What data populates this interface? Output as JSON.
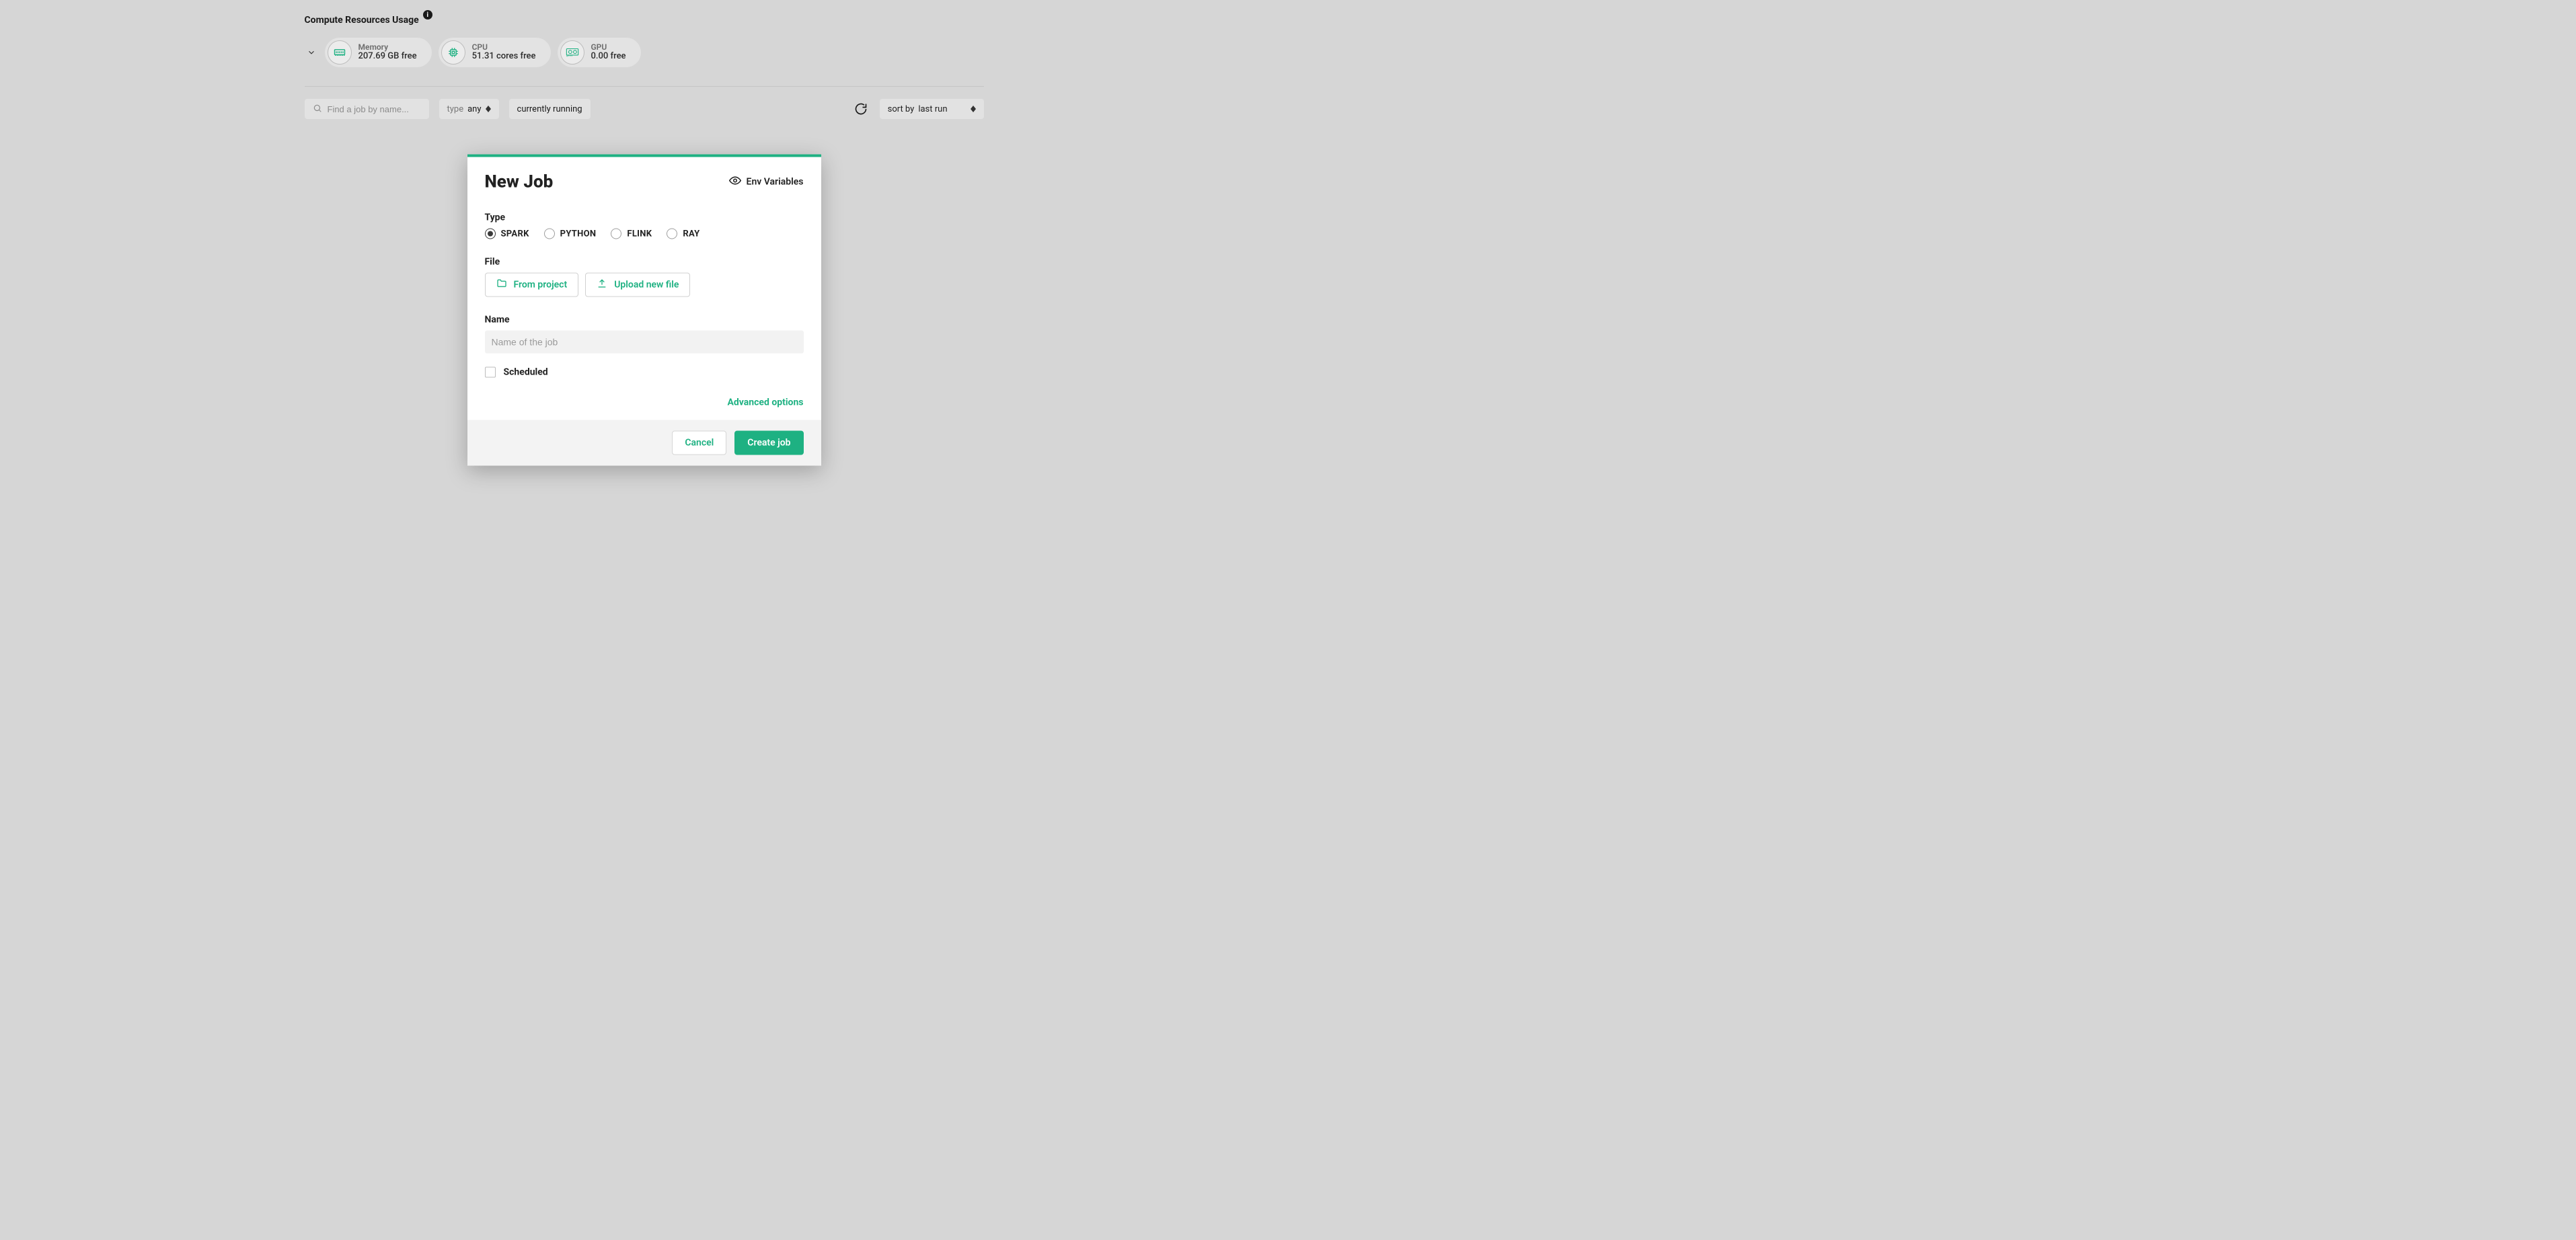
{
  "header": {
    "title": "Compute Resources Usage",
    "info_tooltip": "i"
  },
  "resources": {
    "memory": {
      "label": "Memory",
      "value": "207.69 GB free"
    },
    "cpu": {
      "label": "CPU",
      "value": "51.31 cores free"
    },
    "gpu": {
      "label": "GPU",
      "value": "0.00 free"
    }
  },
  "toolbar": {
    "search_placeholder": "Find a job by name...",
    "type_label": "type",
    "type_value": "any",
    "running_filter": "currently running",
    "sort_label": "sort by",
    "sort_value": "last run"
  },
  "modal": {
    "title": "New Job",
    "env_link": "Env Variables",
    "type_label": "Type",
    "types": [
      "SPARK",
      "PYTHON",
      "FLINK",
      "RAY"
    ],
    "type_selected": 0,
    "file_label": "File",
    "from_project": "From project",
    "upload_new": "Upload new file",
    "name_label": "Name",
    "name_placeholder": "Name of the job",
    "name_value": "",
    "scheduled_label": "Scheduled",
    "scheduled_checked": false,
    "advanced": "Advanced options",
    "cancel": "Cancel",
    "create": "Create job"
  },
  "colors": {
    "accent": "#1eb182"
  }
}
